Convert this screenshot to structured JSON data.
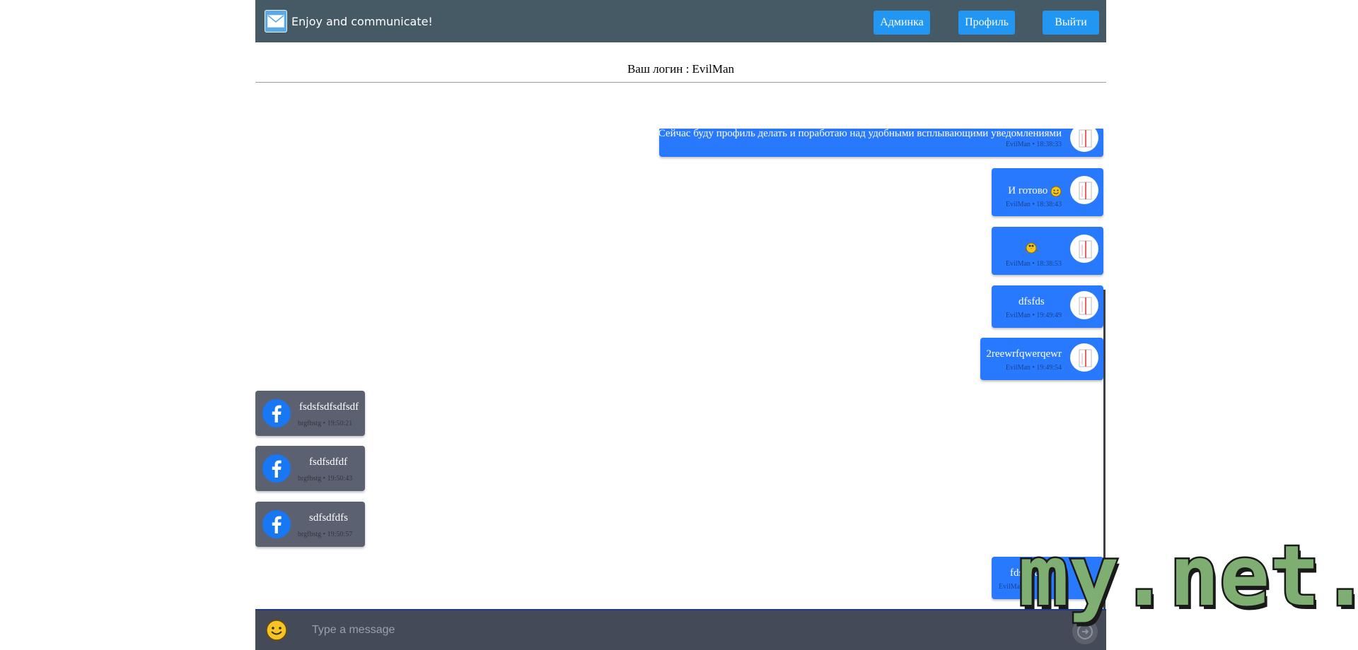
{
  "header": {
    "brand_text": "Enjoy and communicate!",
    "nav": {
      "admin_label": "Админка",
      "profile_label": "Профиль",
      "logout_label": "Выйти"
    }
  },
  "login": {
    "line": "Ваш логин : EvilMan"
  },
  "messages": [
    {
      "direction": "out",
      "text": "Сейчас буду профиль делать и поработаю над удобными всплывающими уведомлениями",
      "author": "EvilMan",
      "time": "18:38:33",
      "meta": "EvilMan • 18:38:33"
    },
    {
      "direction": "out",
      "text": "И готово",
      "emoji": "smile-emoji",
      "author": "EvilMan",
      "time": "18:38:43",
      "meta": "EvilMan • 18:38:43"
    },
    {
      "direction": "out",
      "text": "",
      "emoji": "bird-emoji",
      "author": "EvilMan",
      "time": "18:38:53",
      "meta": "EvilMan • 18:38:53"
    },
    {
      "direction": "out",
      "text": "dfsfds",
      "author": "EvilMan",
      "time": "19:49:49",
      "meta": "EvilMan • 19:49:49"
    },
    {
      "direction": "out",
      "text": "2reewrfqwerqewr",
      "author": "EvilMan",
      "time": "19:49:54",
      "meta": "EvilMan • 19:49:54"
    },
    {
      "direction": "in",
      "text": "fsdsfsdfsdfsdf",
      "author": "brgfbstg",
      "time": "19:50:21",
      "meta": "brgfbstg • 19:50:21"
    },
    {
      "direction": "in",
      "text": "fsdfsdfdf",
      "author": "brgfbstg",
      "time": "19:50:43",
      "meta": "brgfbstg • 19:50:43"
    },
    {
      "direction": "in",
      "text": "sdfsdfdfs",
      "author": "brgfbstg",
      "time": "19:50:57",
      "meta": "brgfbstg • 19:50:57"
    },
    {
      "direction": "out",
      "text": "fdsf...dsf",
      "author": "EvilMan",
      "time": "",
      "meta": "EvilMan"
    }
  ],
  "composer": {
    "placeholder": "Type a message"
  },
  "watermark": {
    "text": "my.net.ru"
  },
  "colors": {
    "header_bg": "#455a64",
    "nav_button": "#2196f3",
    "outgoing_bubble": "#2979ff",
    "incoming_bubble": "#5b6170",
    "composer_bg": "#454a59",
    "watermark_fill": "#7fae72"
  }
}
